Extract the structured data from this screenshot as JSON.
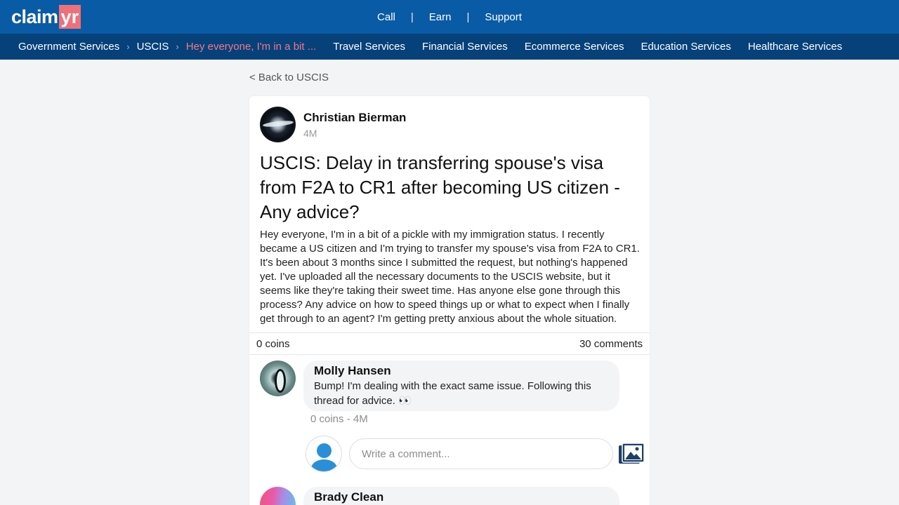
{
  "header": {
    "logo_main": "claim",
    "logo_accent": "yr",
    "nav": [
      "Call",
      "Earn",
      "Support"
    ],
    "separator": "|"
  },
  "subnav": {
    "breadcrumbs": [
      "Government Services",
      "USCIS",
      "Hey everyone, I'm in a bit ..."
    ],
    "chevron": "›",
    "services": [
      "Travel Services",
      "Financial Services",
      "Ecommerce Services",
      "Education Services",
      "Healthcare Services"
    ]
  },
  "back_link": "< Back to USCIS",
  "post": {
    "author": "Christian Bierman",
    "time": "4M",
    "title": "USCIS: Delay in transferring spouse's visa from F2A to CR1 after becoming US citizen - Any advice?",
    "body": "Hey everyone, I'm in a bit of a pickle with my immigration status. I recently became a US citizen and I'm trying to transfer my spouse's visa from F2A to CR1. It's been about 3 months since I submitted the request, but nothing's happened yet. I've uploaded all the necessary documents to the USCIS website, but it seems like they're taking their sweet time. Has anyone else gone through this process? Any advice on how to speed things up or what to expect when I finally get through to an agent? I'm getting pretty anxious about the whole situation.",
    "coins": "0 coins",
    "comments": "30 comments"
  },
  "comments": [
    {
      "name": "Molly Hansen",
      "text": "Bump! I'm dealing with the exact same issue. Following this thread for advice. 👀",
      "meta": "0 coins - 4M"
    },
    {
      "name": "Brady Clean",
      "text": "",
      "meta": ""
    }
  ],
  "reply": {
    "placeholder": "Write a comment..."
  },
  "colors": {
    "topbar": "#0a5ba5",
    "subnav": "#06417a",
    "accent": "#f0707a"
  },
  "icons": [
    "user-avatar-icon",
    "image-upload-icon",
    "chevron-right-icon"
  ]
}
